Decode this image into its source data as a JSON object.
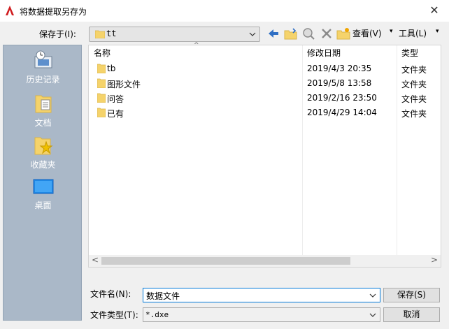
{
  "window": {
    "title": "将数据提取另存为",
    "close": "✕"
  },
  "toolbar": {
    "save_in_label": "保存于(I):",
    "location": "tt",
    "view_menu": "查看(V)",
    "tools_menu": "工具(L)"
  },
  "sidebar": {
    "items": [
      {
        "label": "历史记录"
      },
      {
        "label": "文档"
      },
      {
        "label": "收藏夹"
      },
      {
        "label": "桌面"
      }
    ]
  },
  "list": {
    "columns": {
      "name": "名称",
      "modified": "修改日期",
      "type": "类型"
    },
    "rows": [
      {
        "name": "tb",
        "modified": "2019/4/3 20:35",
        "type": "文件夹"
      },
      {
        "name": "图形文件",
        "modified": "2019/5/8 13:58",
        "type": "文件夹"
      },
      {
        "name": "问答",
        "modified": "2019/2/16 23:50",
        "type": "文件夹"
      },
      {
        "name": "已有",
        "modified": "2019/4/29 14:04",
        "type": "文件夹"
      }
    ]
  },
  "footer": {
    "filename_label": "文件名(N):",
    "filename_value": "数据文件",
    "filetype_label": "文件类型(T):",
    "filetype_value": "*.dxe",
    "save_button": "保存(S)",
    "cancel_button": "取消"
  },
  "colors": {
    "accent": "#0078d7",
    "sidebar": "#aab8c8",
    "folder": "#f5d36b",
    "app_red": "#d01c1f"
  }
}
